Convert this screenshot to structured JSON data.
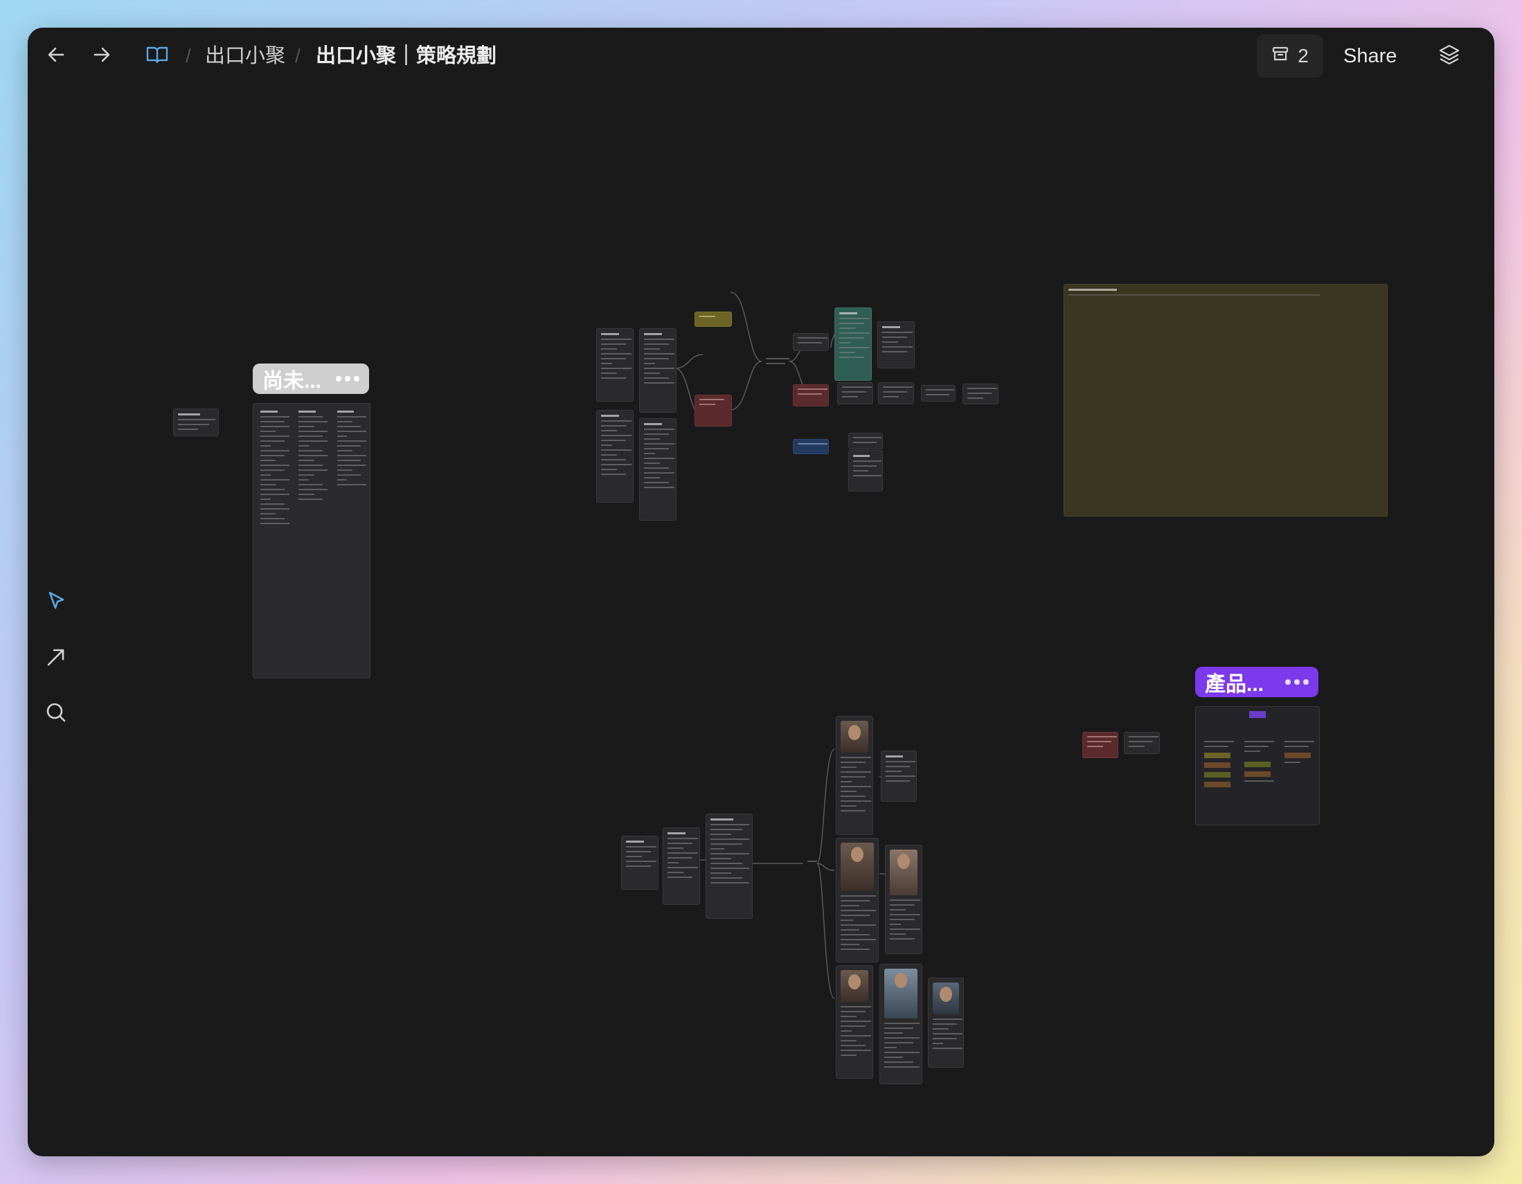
{
  "topbar": {
    "breadcrumb": [
      {
        "label": "出口小聚"
      },
      {
        "label": "出口小聚｜策略規劃"
      }
    ],
    "separator": "/",
    "archive_count": "2",
    "share_label": "Share"
  },
  "icons": {
    "back": "arrow-left-icon",
    "forward": "arrow-right-icon",
    "book": "book-open-icon",
    "archive": "archive-icon",
    "layers": "layers-icon",
    "select": "pointer-icon",
    "connect": "arrow-diagonal-icon",
    "search": "search-icon"
  },
  "canvas": {
    "clusters": [
      {
        "label": "尚未...",
        "color": "#cfcfcf"
      },
      {
        "label": "產品...",
        "color": "#7c3aed"
      }
    ]
  },
  "colors": {
    "accent_blue": "#5aa8e6",
    "window_bg": "#1a1a1a",
    "note_olive": "#3a3622",
    "green_node": "#2f5e54",
    "red_node": "#5a2a2c",
    "yellow_node": "#6b6424",
    "blue_node": "#233a5e",
    "purple": "#7c3aed"
  }
}
